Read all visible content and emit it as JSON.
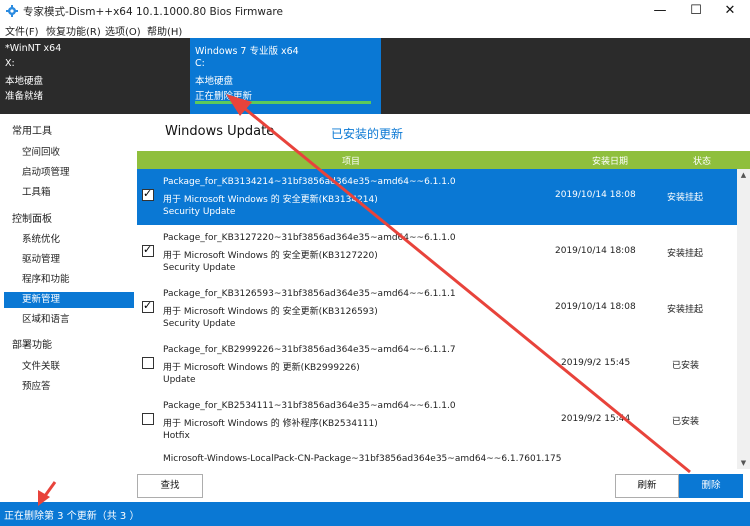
{
  "titlebar": {
    "title": "专家模式-Dism++x64 10.1.1000.80 Bios Firmware",
    "minimize_glyph": "—",
    "maximize_glyph": "☐",
    "close_glyph": "✕"
  },
  "menubar": [
    "文件(F)",
    "恢复功能(R)",
    "选项(O)",
    "帮助(H)"
  ],
  "sessions": [
    {
      "name": "*WinNT x64",
      "drive": "X:",
      "disk": "本地硬盘",
      "status": "准备就绪",
      "active": false
    },
    {
      "name": "Windows 7 专业版 x64",
      "drive": "C:",
      "disk": "本地硬盘",
      "status": "正在删除更新",
      "active": true,
      "progress": 1.0
    }
  ],
  "sidebar": {
    "groups": [
      {
        "label": "常用工具",
        "items": [
          {
            "label": "空间回收"
          },
          {
            "label": "启动项管理"
          },
          {
            "label": "工具箱"
          }
        ]
      },
      {
        "label": "控制面板",
        "items": [
          {
            "label": "系统优化"
          },
          {
            "label": "驱动管理"
          },
          {
            "label": "程序和功能"
          },
          {
            "label": "更新管理",
            "selected": true
          },
          {
            "label": "区域和语言"
          }
        ]
      },
      {
        "label": "部署功能",
        "items": [
          {
            "label": "文件关联"
          },
          {
            "label": "预应答"
          }
        ]
      }
    ]
  },
  "tabs": {
    "windows_update": "Windows Update",
    "installed_updates": "已安装的更新"
  },
  "columns": {
    "item": "项目",
    "date": "安装日期",
    "status": "状态"
  },
  "rows": [
    {
      "checked": true,
      "selected": true,
      "package": "Package_for_KB3134214~31bf3856ad364e35~amd64~~6.1.1.0",
      "desc": "用于 Microsoft Windows 的 安全更新(KB3134214)",
      "type": "Security Update",
      "date": "2019/10/14 18:08",
      "status": "安装挂起"
    },
    {
      "checked": true,
      "selected": false,
      "package": "Package_for_KB3127220~31bf3856ad364e35~amd64~~6.1.1.0",
      "desc": "用于 Microsoft Windows 的 安全更新(KB3127220)",
      "type": "Security Update",
      "date": "2019/10/14 18:08",
      "status": "安装挂起"
    },
    {
      "checked": true,
      "selected": false,
      "package": "Package_for_KB3126593~31bf3856ad364e35~amd64~~6.1.1.1",
      "desc": "用于 Microsoft Windows 的 安全更新(KB3126593)",
      "type": "Security Update",
      "date": "2019/10/14 18:08",
      "status": "安装挂起"
    },
    {
      "checked": false,
      "selected": false,
      "package": "Package_for_KB2999226~31bf3856ad364e35~amd64~~6.1.1.7",
      "desc": "用于 Microsoft Windows 的 更新(KB2999226)",
      "type": "Update",
      "date": "2019/9/2 15:45",
      "status": "已安装"
    },
    {
      "checked": false,
      "selected": false,
      "package": "Package_for_KB2534111~31bf3856ad364e35~amd64~~6.1.1.0",
      "desc": "用于 Microsoft Windows 的 修补程序(KB2534111)",
      "type": "Hotfix",
      "date": "2019/9/2 15:44",
      "status": "已安装"
    }
  ],
  "partial_row": {
    "package": "Microsoft-Windows-LocalPack-CN-Package~31bf3856ad364e35~amd64~~6.1.7601.175"
  },
  "buttons": {
    "find": "查找",
    "refresh": "刷新",
    "delete": "删除"
  },
  "statusbar": {
    "text": "正在删除第 3 个更新（共 3 ）"
  },
  "colors": {
    "accent": "#0a78d4",
    "header_green": "#8fbf3d",
    "annotation_red": "#e8433b"
  }
}
